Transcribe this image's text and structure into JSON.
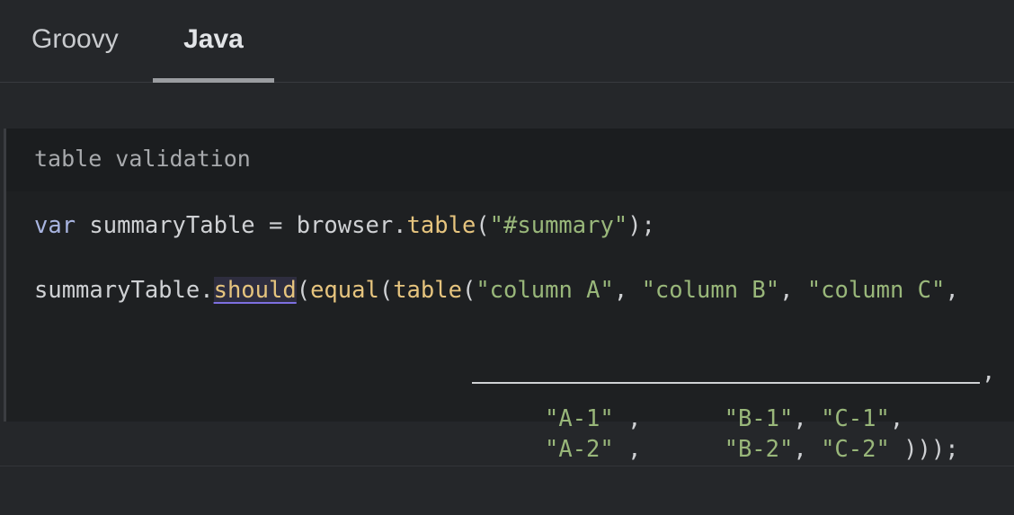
{
  "tabs": [
    {
      "label": "Groovy",
      "active": false
    },
    {
      "label": "Java",
      "active": true
    }
  ],
  "code": {
    "title": "table validation",
    "line1": {
      "kw": "var",
      "name": " summaryTable = ",
      "obj": "browser.",
      "fn": "table",
      "open": "(",
      "str": "\"#summary\"",
      "close": ");"
    },
    "line2": {
      "obj": "summaryTable.",
      "should": "should",
      "p1": "(",
      "equal": "equal",
      "p2": "(",
      "table": "table",
      "p3": "(",
      "colA": "\"column A\"",
      "sep1": ", ",
      "colB": "\"column B\"",
      "sep2": ", ",
      "colC": "\"column C\"",
      "end": ","
    },
    "underline_comma": ",",
    "row1": {
      "a": "\"A-1\"",
      "sepA": " ,      ",
      "b": "\"B-1\"",
      "sepB": ", ",
      "c": "\"C-1\"",
      "end": ","
    },
    "row2": {
      "a": "\"A-2\"",
      "sepA": " ,      ",
      "b": "\"B-2\"",
      "sepB": ", ",
      "c": "\"C-2\"",
      "end": " )));"
    }
  },
  "colors": {
    "background": "#25272a",
    "code_background": "#1e2022",
    "keyword": "#a8b4e0",
    "function": "#e6c47e",
    "string": "#99b77a"
  }
}
